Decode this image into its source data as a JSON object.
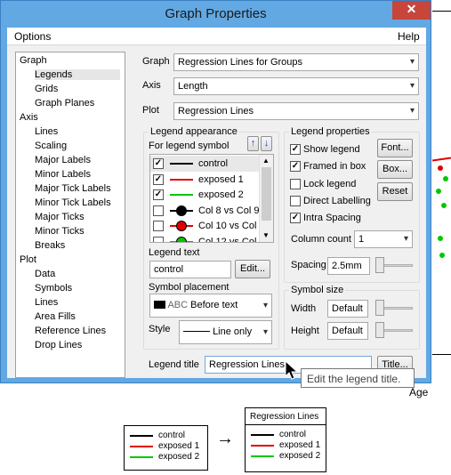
{
  "window": {
    "title": "Graph Properties",
    "close": "✕"
  },
  "menu": {
    "options": "Options",
    "help": "Help"
  },
  "tree": [
    {
      "label": "Graph",
      "level": 0
    },
    {
      "label": "Legends",
      "level": 1,
      "selected": true
    },
    {
      "label": "Grids",
      "level": 1
    },
    {
      "label": "Graph Planes",
      "level": 1
    },
    {
      "label": "Axis",
      "level": 0
    },
    {
      "label": "Lines",
      "level": 1
    },
    {
      "label": "Scaling",
      "level": 1
    },
    {
      "label": "Major Labels",
      "level": 1
    },
    {
      "label": "Minor Labels",
      "level": 1
    },
    {
      "label": "Major Tick Labels",
      "level": 1
    },
    {
      "label": "Minor Tick Labels",
      "level": 1
    },
    {
      "label": "Major Ticks",
      "level": 1
    },
    {
      "label": "Minor Ticks",
      "level": 1
    },
    {
      "label": "Breaks",
      "level": 1
    },
    {
      "label": "Plot",
      "level": 0
    },
    {
      "label": "Data",
      "level": 1
    },
    {
      "label": "Symbols",
      "level": 1
    },
    {
      "label": "Lines",
      "level": 1
    },
    {
      "label": "Area Fills",
      "level": 1
    },
    {
      "label": "Reference Lines",
      "level": 1
    },
    {
      "label": "Drop Lines",
      "level": 1
    }
  ],
  "selectors": {
    "graph_label": "Graph",
    "graph_value": "Regression Lines for Groups",
    "axis_label": "Axis",
    "axis_value": "Length",
    "plot_label": "Plot",
    "plot_value": "Regression Lines"
  },
  "legend_appearance": {
    "title": "Legend appearance",
    "for_symbol": "For legend symbol",
    "up_icon": "↑",
    "down_icon": "↓",
    "items": [
      {
        "label": "control",
        "checked": true,
        "color": "#000000",
        "kind": "line"
      },
      {
        "label": "exposed 1",
        "checked": true,
        "color": "#e00000",
        "kind": "line"
      },
      {
        "label": "exposed 2",
        "checked": true,
        "color": "#00c800",
        "kind": "line"
      },
      {
        "label": "Col 8 vs Col 9",
        "checked": false,
        "color": "#000000",
        "kind": "dot"
      },
      {
        "label": "Col 10 vs Col",
        "checked": false,
        "color": "#e00000",
        "kind": "dot"
      },
      {
        "label": "Col 12 vs Col",
        "checked": false,
        "color": "#00c800",
        "kind": "dot"
      }
    ],
    "check_mark": "✓",
    "legend_text_label": "Legend text",
    "legend_text_value": "control",
    "edit_button": "Edit...",
    "symbol_placement_label": "Symbol placement",
    "symbol_placement_value": "Before text",
    "symbol_placement_sample": "ABC",
    "style_label": "Style",
    "style_value": "Line only"
  },
  "legend_properties": {
    "title": "Legend properties",
    "show_legend": "Show legend",
    "show_legend_checked": true,
    "framed": "Framed in box",
    "framed_checked": true,
    "lock": "Lock legend",
    "lock_checked": false,
    "direct": "Direct Labelling",
    "direct_checked": false,
    "intra": "Intra Spacing",
    "intra_checked": true,
    "font_button": "Font...",
    "box_button": "Box...",
    "reset_button": "Reset",
    "column_count_label": "Column count",
    "column_count_value": "1",
    "spacing_label": "Spacing",
    "spacing_value": "2.5mm",
    "spacing_level": 0
  },
  "symbol_size": {
    "title": "Symbol size",
    "width_label": "Width",
    "width_value": "Default",
    "width_level": 0,
    "height_label": "Height",
    "height_value": "Default",
    "height_level": 0
  },
  "legend_title": {
    "label": "Legend title",
    "value": "Regression Lines",
    "button": "Title..."
  },
  "tooltip": "Edit the legend title.",
  "background_axis_label": "Age",
  "example": {
    "arrow": "→",
    "before": [
      {
        "label": "control",
        "color": "#000000"
      },
      {
        "label": "exposed 1",
        "color": "#e00000"
      },
      {
        "label": "exposed 2",
        "color": "#00c800"
      }
    ],
    "after_title": "Regression Lines",
    "after": [
      {
        "label": "control",
        "color": "#000000"
      },
      {
        "label": "exposed 1",
        "color": "#e00000"
      },
      {
        "label": "exposed 2",
        "color": "#00c800"
      }
    ]
  }
}
